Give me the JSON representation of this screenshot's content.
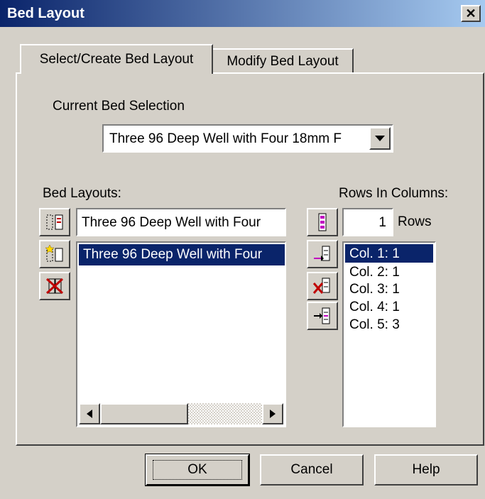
{
  "window": {
    "title": "Bed Layout",
    "close_glyph": "✕"
  },
  "tabs": [
    {
      "label": "Select/Create Bed Layout",
      "active": true
    },
    {
      "label": "Modify Bed Layout",
      "active": false
    }
  ],
  "current_bed_selection": {
    "legend": "Current Bed Selection",
    "value": "Three 96 Deep Well with Four 18mm F"
  },
  "bed_layouts": {
    "label": "Bed Layouts:",
    "name_input": "Three 96 Deep Well with Four",
    "items": [
      {
        "label": "Three 96 Deep Well with Four",
        "selected": true
      }
    ],
    "icons": [
      "rename-layout-icon",
      "new-layout-icon",
      "delete-layout-icon"
    ]
  },
  "rows_in_columns": {
    "label": "Rows In Columns:",
    "rows_value": "1",
    "rows_unit": "Rows",
    "items": [
      {
        "label": "Col. 1: 1",
        "selected": true
      },
      {
        "label": "Col. 2: 1",
        "selected": false
      },
      {
        "label": "Col. 3: 1",
        "selected": false
      },
      {
        "label": "Col. 4: 1",
        "selected": false
      },
      {
        "label": "Col. 5: 3",
        "selected": false
      }
    ],
    "icons": [
      "set-rows-icon",
      "add-column-icon",
      "delete-column-icon",
      "insert-column-icon"
    ]
  },
  "buttons": {
    "ok": "OK",
    "cancel": "Cancel",
    "help": "Help"
  },
  "colors": {
    "selection": "#0a246a",
    "face": "#d4d0c8",
    "title_start": "#0a246a",
    "title_end": "#a6caf0",
    "icon_accent": "#c00000"
  }
}
